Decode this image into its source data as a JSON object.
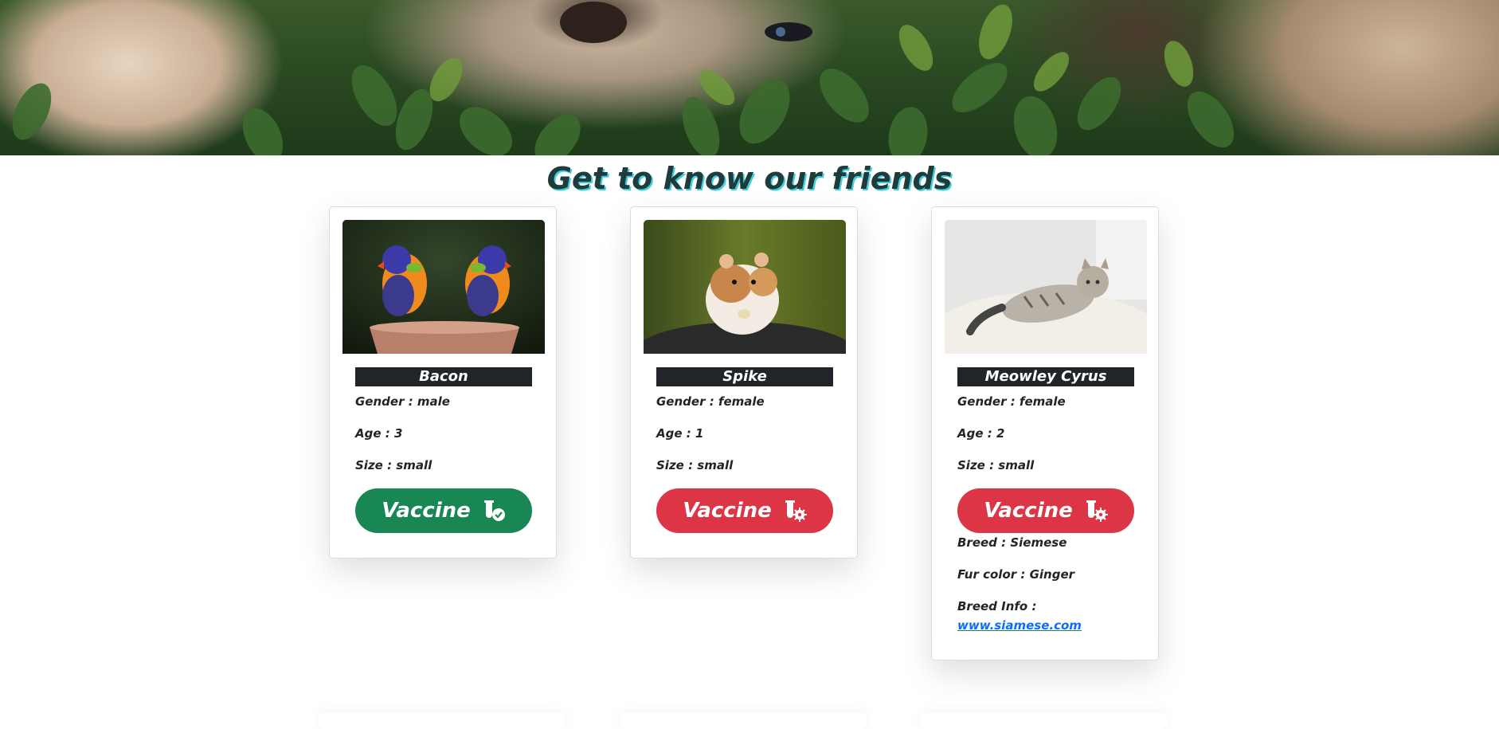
{
  "heading": "Get to know our friends",
  "colors": {
    "vaccinated": "#198754",
    "not_vaccinated": "#dc3545",
    "name_bar": "#212529",
    "heading_shadow": "#3fd0de",
    "link": "#0d6efd"
  },
  "pets": [
    {
      "name": "Bacon",
      "gender": "Gender : male",
      "age": "Age : 3",
      "size": "Size : small",
      "vaccine_label": "Vaccine",
      "vaccinated": true,
      "vaccine_icon": "vial-check-icon"
    },
    {
      "name": "Spike",
      "gender": "Gender : female",
      "age": "Age : 1",
      "size": "Size : small",
      "vaccine_label": "Vaccine",
      "vaccinated": false,
      "vaccine_icon": "vial-virus-icon"
    },
    {
      "name": "Meowley Cyrus",
      "gender": "Gender : female",
      "age": "Age : 2",
      "size": "Size : small",
      "vaccine_label": "Vaccine",
      "vaccinated": false,
      "vaccine_icon": "vial-virus-icon",
      "breed": "Breed : Siemese",
      "fur_color": "Fur color : Ginger",
      "breed_info_label": "Breed Info :",
      "breed_info_link": "www.siamese.com"
    }
  ]
}
